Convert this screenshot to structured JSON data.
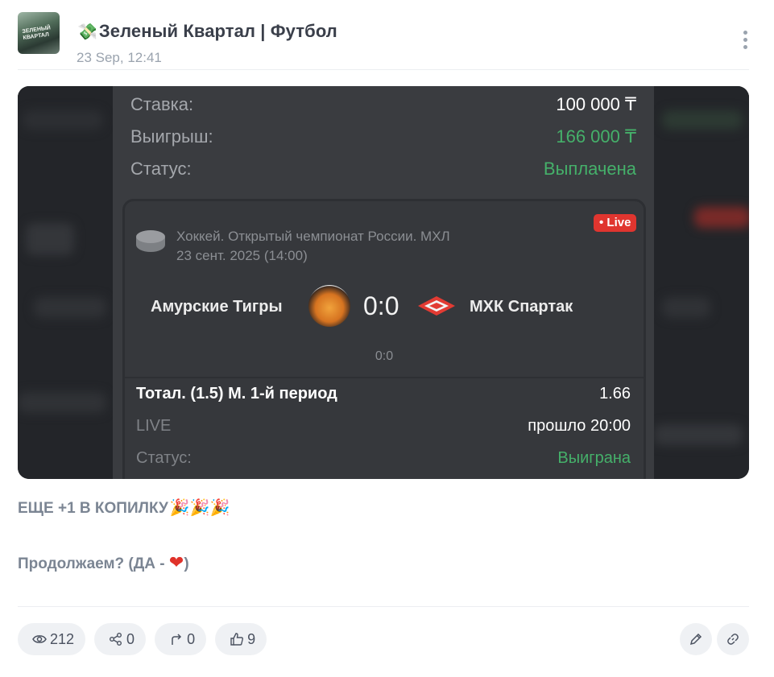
{
  "header": {
    "title_emoji": "💸",
    "title": "Зеленый Квартал | Футбол",
    "date": "23 Sep, 12:41",
    "avatar_text": "ЗЕЛЕНЫЙ КВАРТАЛ"
  },
  "screenshot": {
    "stake_label": "Ставка:",
    "stake_value": "100 000 ₸",
    "win_label": "Выигрыш:",
    "win_value": "166 000 ₸",
    "status_label": "Статус:",
    "status_value": "Выплачена",
    "league": "Хоккей. Открытый чемпионат России. МХЛ",
    "match_date": "23 сент. 2025 (14:00)",
    "live_badge": "• Live",
    "team_home": "Амурские Тигры",
    "score": "0:0",
    "team_away": "МХК Спартак",
    "subscore": "0:0",
    "bet_label": "Тотал. (1.5) М. 1-й период",
    "bet_odds": "1.66",
    "live_label": "LIVE",
    "elapsed": "прошло 20:00",
    "bet_status_label": "Статус:",
    "bet_status_value": "Выиграна",
    "colors": {
      "win": "#45b06a",
      "live": "#e0352f"
    }
  },
  "post": {
    "line1": "ЕЩЕ +1 В КОПИЛКУ",
    "line1_emoji": "🎉🎉🎉",
    "line2_start": "Продолжаем? (ДА - ",
    "line2_heart": "❤",
    "line2_end": ")"
  },
  "footer": {
    "views": "212",
    "shares": "0",
    "forwards": "0",
    "likes": "9",
    "icons": [
      "eye-icon",
      "share-icon",
      "forward-icon",
      "thumbs-up-icon",
      "pencil-icon",
      "link-icon"
    ]
  }
}
